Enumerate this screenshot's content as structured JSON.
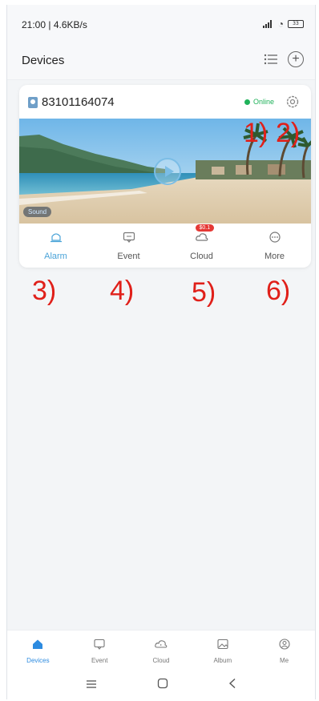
{
  "status_bar": {
    "time": "21:00 | 4.6KB/s",
    "battery": "33"
  },
  "header": {
    "title": "Devices"
  },
  "device": {
    "id": "83101164074",
    "status": "Online",
    "sound_label": "Sound",
    "actions": [
      {
        "label": "Alarm",
        "icon": "alarm-bell-icon"
      },
      {
        "label": "Event",
        "icon": "event-message-icon"
      },
      {
        "label": "Cloud",
        "icon": "cloud-icon",
        "badge": "$0.1"
      },
      {
        "label": "More",
        "icon": "more-dots-icon"
      }
    ]
  },
  "annotations": [
    "1)",
    "2)",
    "3)",
    "4)",
    "5)",
    "6)"
  ],
  "bottom_nav": [
    {
      "label": "Devices",
      "icon": "home-icon"
    },
    {
      "label": "Event",
      "icon": "event-icon"
    },
    {
      "label": "Cloud",
      "icon": "cloud-icon"
    },
    {
      "label": "Album",
      "icon": "album-icon"
    },
    {
      "label": "Me",
      "icon": "profile-icon"
    }
  ],
  "colors": {
    "accent": "#2d8be0",
    "online": "#1fb25a",
    "annotation": "#e0201a",
    "badge": "#e53935"
  }
}
